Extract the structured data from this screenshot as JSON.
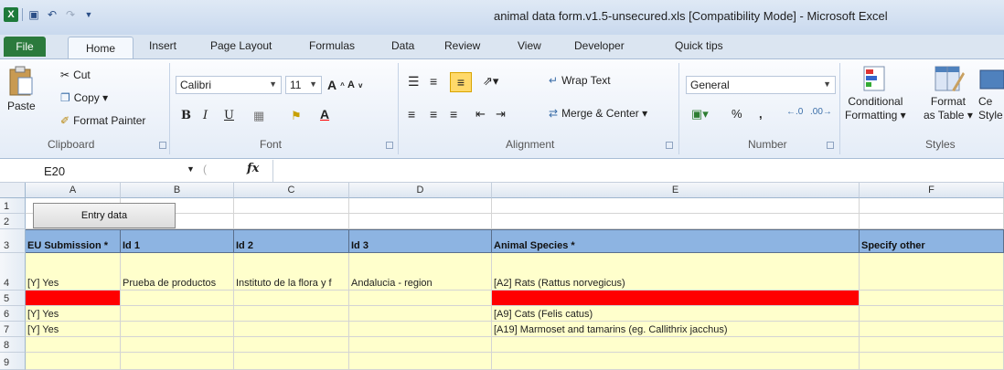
{
  "window": {
    "title": "animal data form.v1.5-unsecured.xls  [Compatibility Mode]  -  Microsoft Excel"
  },
  "tabs": [
    "File",
    "Home",
    "Insert",
    "Page Layout",
    "Formulas",
    "Data",
    "Review",
    "View",
    "Developer",
    "Quick tips"
  ],
  "clipboard": {
    "paste": "Paste",
    "cut": "Cut",
    "copy": "Copy ▾",
    "format_painter": "Format Painter",
    "label": "Clipboard"
  },
  "font": {
    "name": "Calibri",
    "size": "11",
    "label": "Font"
  },
  "alignment": {
    "wrap_text": "Wrap Text",
    "merge_center": "Merge & Center ▾",
    "label": "Alignment"
  },
  "number": {
    "format": "General",
    "label": "Number"
  },
  "styles": {
    "conditional_formatting": "Conditional",
    "conditional_formatting_2": "Formatting ▾",
    "format_as_table": "Format",
    "format_as_table_2": "as Table ▾",
    "cell_styles": "Ce",
    "cell_styles_2": "Style",
    "label": "Styles"
  },
  "formula_bar": {
    "name_box": "E20",
    "fx": "fx",
    "value": ""
  },
  "columns": [
    "A",
    "B",
    "C",
    "D",
    "E",
    "F"
  ],
  "rows": [
    "1",
    "2",
    "3",
    "4",
    "5",
    "6",
    "7",
    "8",
    "9"
  ],
  "sheet": {
    "entry_button": "Entry data",
    "headers": [
      "EU Submission *",
      "Id 1",
      "Id 2",
      "Id 3",
      "Animal Species *",
      "Specify other"
    ],
    "row4": [
      "[Y] Yes",
      "Prueba de productos",
      "Instituto de la flora y f",
      "Andalucia - region",
      "[A2] Rats (Rattus norvegicus)",
      ""
    ],
    "row6": [
      "[Y] Yes",
      "",
      "",
      "",
      "[A9] Cats (Felis catus)",
      ""
    ],
    "row7": [
      "[Y] Yes",
      "",
      "",
      "",
      "[A19] Marmoset and tamarins (eg. Callithrix jacchus)",
      ""
    ]
  },
  "colors": {
    "header_fill": "#8db4e2",
    "input_fill": "#ffffcc",
    "error_fill": "#ff0000",
    "file_tab": "#2b7a3c"
  }
}
